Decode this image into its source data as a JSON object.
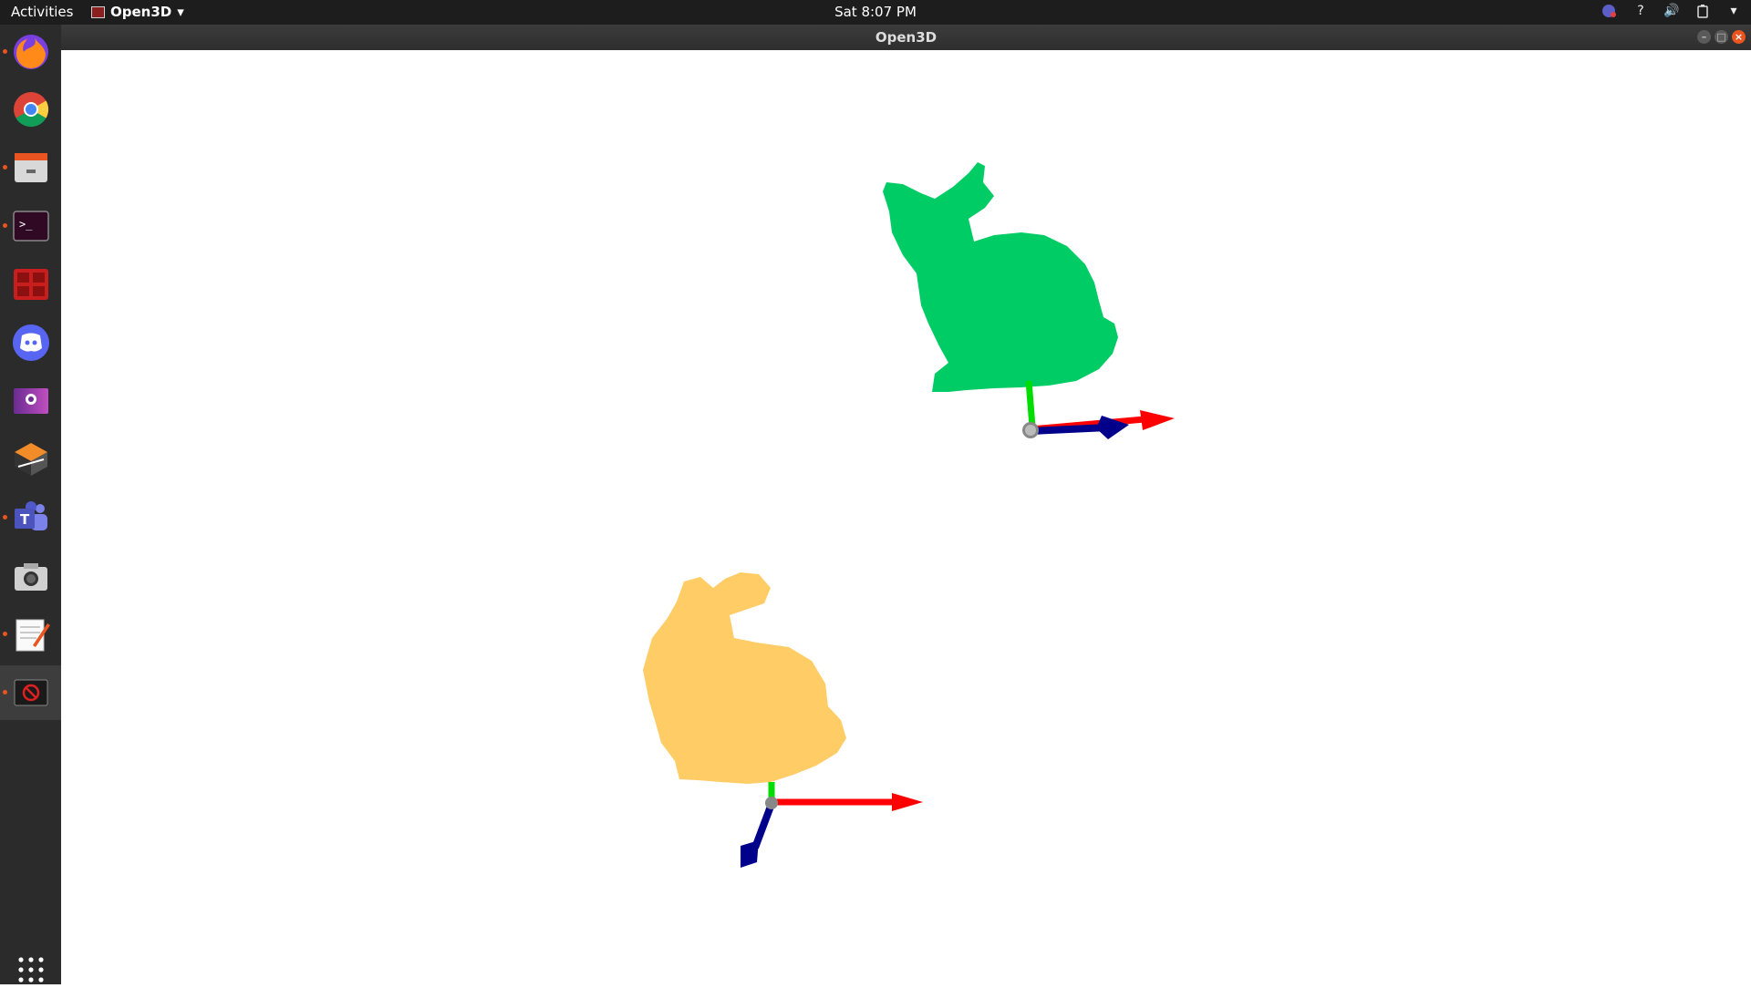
{
  "topbar": {
    "activities": "Activities",
    "app_menu": "Open3D",
    "clock": "Sat  8:07 PM",
    "tray_icons": [
      "teams-notification-icon",
      "help-icon",
      "volume-icon",
      "battery-icon",
      "system-menu-chevron-icon"
    ]
  },
  "dock": {
    "items": [
      {
        "name": "firefox",
        "running": true
      },
      {
        "name": "chrome",
        "running": false
      },
      {
        "name": "files",
        "running": true
      },
      {
        "name": "terminal",
        "running": true
      },
      {
        "name": "app-red",
        "running": false
      },
      {
        "name": "discord",
        "running": false
      },
      {
        "name": "video-app",
        "running": false
      },
      {
        "name": "box-app",
        "running": false
      },
      {
        "name": "teams",
        "running": true
      },
      {
        "name": "camera",
        "running": false
      },
      {
        "name": "text-editor",
        "running": true
      },
      {
        "name": "open3d",
        "running": true,
        "active": true
      }
    ],
    "show_apps": "show-applications-icon"
  },
  "window": {
    "title": "Open3D"
  },
  "scene": {
    "objects": [
      {
        "name": "bunny-green",
        "color": "#00cc66"
      },
      {
        "name": "bunny-orange",
        "color": "#ffcc66"
      }
    ],
    "axis_colors": {
      "x": "#ff0000",
      "y": "#00dd00",
      "z": "#00008b"
    }
  }
}
